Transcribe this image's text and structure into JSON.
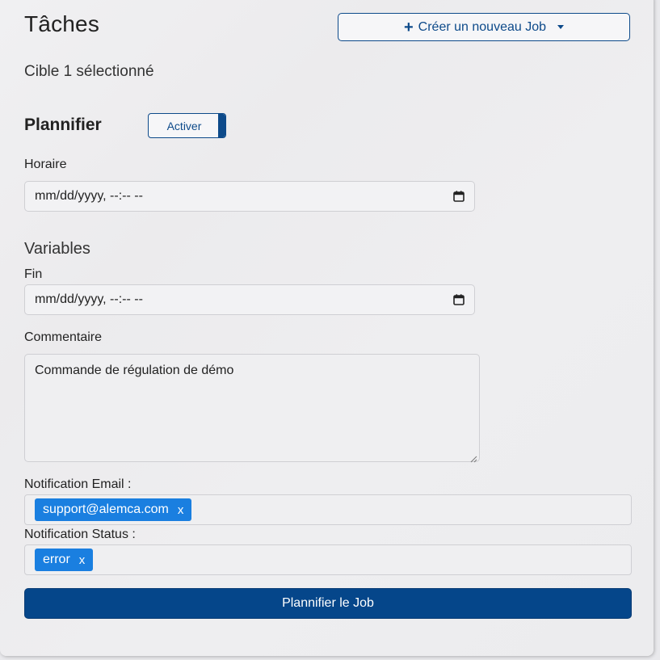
{
  "header": {
    "title": "Tâches",
    "create_button": {
      "icon": "plus-icon",
      "label": "Créer un nouveau Job",
      "caret": "chevron-down-icon"
    }
  },
  "selection": {
    "text": "Cible 1 sélectionné"
  },
  "schedule": {
    "title": "Plannifier",
    "toggle_label": "Activer",
    "horaire_label": "Horaire",
    "horaire_value": "mm/dd/yyyy, --:-- --"
  },
  "variables": {
    "title": "Variables",
    "fin_label": "Fin",
    "fin_value": "mm/dd/yyyy, --:-- --",
    "comment_label": "Commentaire",
    "comment_value": "Commande de régulation de démo"
  },
  "notifications": {
    "email_label": "Notification Email :",
    "email_tags": [
      "support@alemca.com"
    ],
    "status_label": "Notification Status :",
    "status_tags": [
      "error"
    ],
    "remove_glyph": "x"
  },
  "footer": {
    "submit_label": "Plannifier le Job"
  },
  "colors": {
    "primary": "#05468a",
    "tag": "#1a7fe0",
    "border": "#0d4a8a"
  }
}
